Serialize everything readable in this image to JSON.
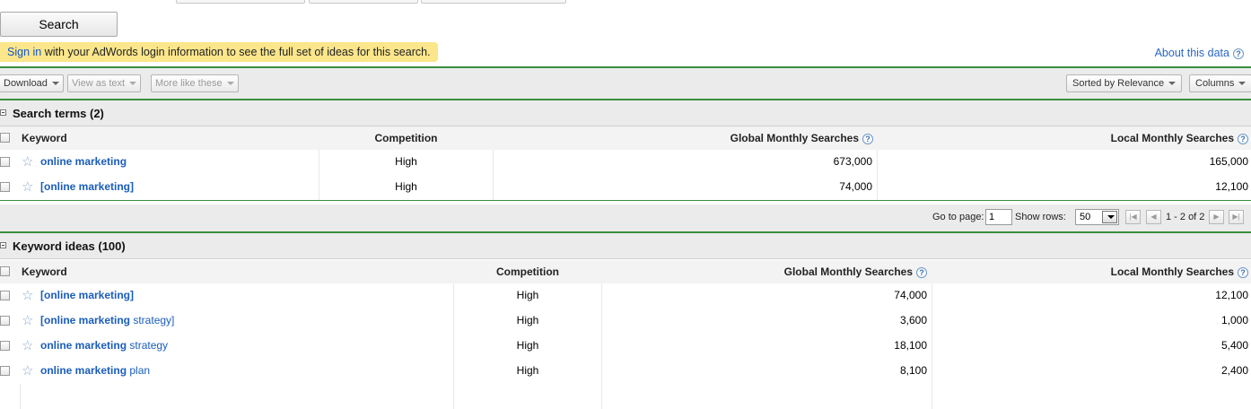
{
  "search_button": "Search",
  "signin_banner": {
    "link": "Sign in",
    "text": " with your AdWords login information to see the full set of ideas for this search."
  },
  "about_link": "About this data",
  "help_glyph": "?",
  "toolbar": {
    "download": "Download",
    "view_as_text": "View as text",
    "more_like_these": "More like these",
    "sorted_by": "Sorted by Relevance",
    "columns": "Columns"
  },
  "columns": {
    "keyword": "Keyword",
    "competition": "Competition",
    "global": "Global Monthly Searches",
    "local": "Local Monthly Searches"
  },
  "search_terms": {
    "title": "Search terms (2)",
    "rows": [
      {
        "kw_bold": "online marketing",
        "kw_rest": "",
        "competition": "High",
        "global": "673,000",
        "local": "165,000"
      },
      {
        "kw_bold": "[online marketing]",
        "kw_rest": "",
        "competition": "High",
        "global": "74,000",
        "local": "12,100"
      }
    ]
  },
  "pager": {
    "goto_label": "Go to page:",
    "goto_value": "1",
    "show_rows_label": "Show rows:",
    "show_rows_value": "50",
    "range": "1 - 2 of 2",
    "first_icon": "first-page-icon",
    "prev_icon": "prev-page-icon",
    "next_icon": "next-page-icon",
    "last_icon": "last-page-icon"
  },
  "keyword_ideas": {
    "title": "Keyword ideas (100)",
    "rows": [
      {
        "kw_bold": "[online marketing]",
        "kw_rest": "",
        "competition": "High",
        "global": "74,000",
        "local": "12,100"
      },
      {
        "kw_bold": "[online marketing",
        "kw_rest": " strategy]",
        "competition": "High",
        "global": "3,600",
        "local": "1,000"
      },
      {
        "kw_bold": "online marketing",
        "kw_rest": " strategy",
        "competition": "High",
        "global": "18,100",
        "local": "5,400"
      },
      {
        "kw_bold": "online marketing",
        "kw_rest": " plan",
        "competition": "High",
        "global": "8,100",
        "local": "2,400"
      }
    ]
  },
  "colors": {
    "banner_bg": "#fbe68b",
    "link_blue": "#1a5dbb",
    "divider_green": "#3a8f3a"
  }
}
